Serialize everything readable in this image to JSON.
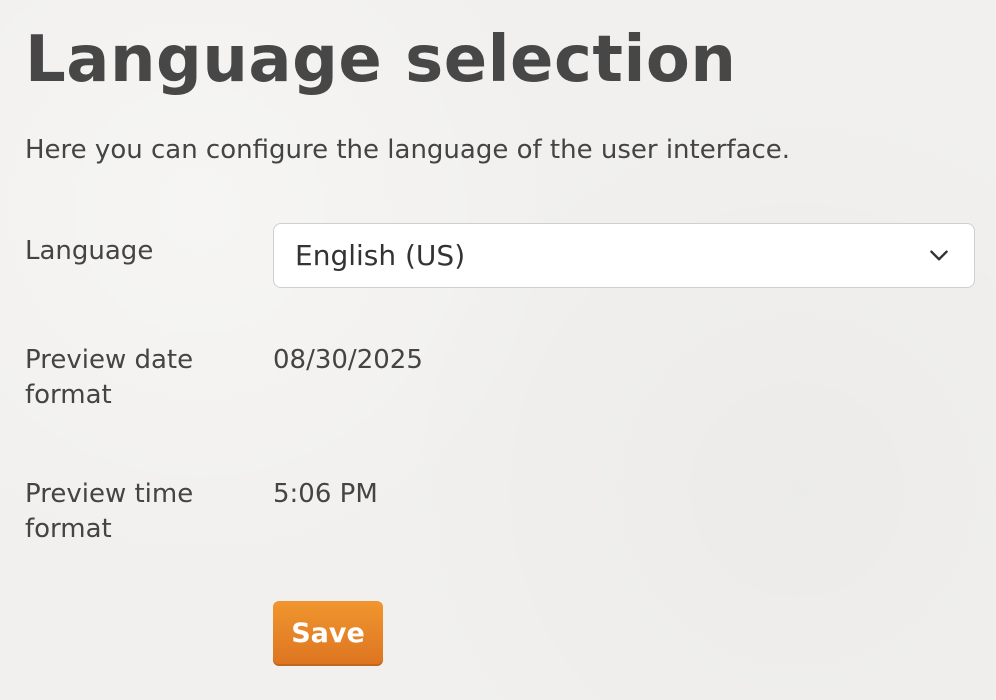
{
  "page": {
    "title": "Language selection",
    "intro": "Here you can configure the language of the user interface."
  },
  "form": {
    "language": {
      "label": "Language",
      "selected": "English (US)",
      "icon": "chevron-down-icon"
    },
    "preview_date": {
      "label": "Preview date format",
      "value": "08/30/2025"
    },
    "preview_time": {
      "label": "Preview time format",
      "value": "5:06 PM"
    }
  },
  "actions": {
    "save_label": "Save",
    "save_color": "#e8842a"
  },
  "colors": {
    "background": "#f1f0ee",
    "text": "#444444"
  }
}
